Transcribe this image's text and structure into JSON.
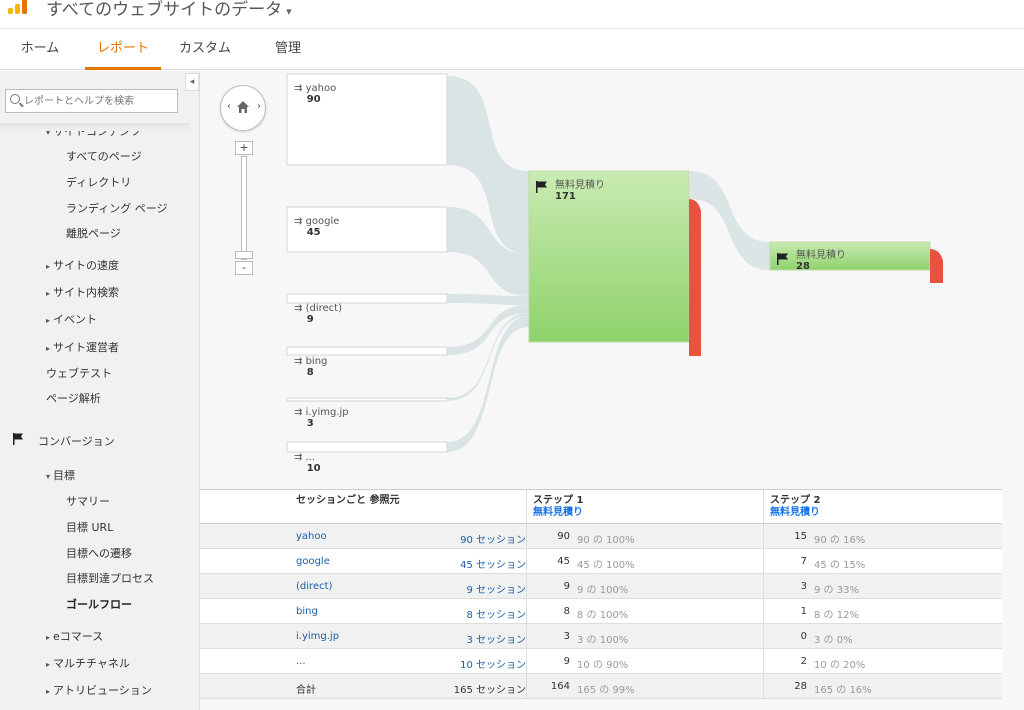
{
  "header": {
    "title": "すべてのウェブサイトのデータ"
  },
  "nav": {
    "tabs": [
      "ホーム",
      "レポート",
      "カスタム",
      "管理"
    ],
    "active": "レポート"
  },
  "sidebar": {
    "search_placeholder": "レポートとヘルプを検索",
    "partial_top": "サイトコンテンツ",
    "items": [
      "すべてのページ",
      "ディレクトリ",
      "ランディング ページ",
      "離脱ページ",
      "サイトの速度",
      "サイト内検索",
      "イベント",
      "サイト運営者",
      "ウェブテスト",
      "ページ解析",
      "コンバージョン",
      "目標",
      "サマリー",
      "目標 URL",
      "目標への遷移",
      "目標到達プロセス",
      "ゴールフロー",
      "eコマース",
      "マルチチャネル",
      "アトリビューション"
    ]
  },
  "flow": {
    "sources": [
      {
        "name": "yahoo",
        "value": "90"
      },
      {
        "name": "google",
        "value": "45"
      },
      {
        "name": "(direct)",
        "value": "9"
      },
      {
        "name": "bing",
        "value": "8"
      },
      {
        "name": "i.yimg.jp",
        "value": "3"
      },
      {
        "name": "...",
        "value": "10"
      }
    ],
    "step1": {
      "name": "無料見積り",
      "value": "171"
    },
    "step2": {
      "name": "無料見積り",
      "value": "28"
    },
    "colors": {
      "node_green": "#8fd26b",
      "dropoff_red": "#e8533f",
      "link_gray": "#d9e4e4"
    }
  },
  "table": {
    "headers": {
      "source": "セッションごと 参照元",
      "step1": "ステップ 1",
      "step1_sub": "無料見積り",
      "step2": "ステップ 2",
      "step2_sub": "無料見積り"
    },
    "rows": [
      {
        "name": "yahoo",
        "sessions": "90 セッション",
        "s1n": "90",
        "s1p": "90 の 100%",
        "s2n": "15",
        "s2p": "90 の 16%"
      },
      {
        "name": "google",
        "sessions": "45 セッション",
        "s1n": "45",
        "s1p": "45 の 100%",
        "s2n": "7",
        "s2p": "45 の 15%"
      },
      {
        "name": "(direct)",
        "sessions": "9 セッション",
        "s1n": "9",
        "s1p": "9 の 100%",
        "s2n": "3",
        "s2p": "9 の 33%"
      },
      {
        "name": "bing",
        "sessions": "8 セッション",
        "s1n": "8",
        "s1p": "8 の 100%",
        "s2n": "1",
        "s2p": "8 の 12%"
      },
      {
        "name": "i.yimg.jp",
        "sessions": "3 セッション",
        "s1n": "3",
        "s1p": "3 の 100%",
        "s2n": "0",
        "s2p": "3 の 0%"
      },
      {
        "name": "...",
        "sessions": "10 セッション",
        "s1n": "9",
        "s1p": "10 の 90%",
        "s2n": "2",
        "s2p": "10 の 20%"
      }
    ],
    "total": {
      "name": "合計",
      "sessions": "165 セッション",
      "s1n": "164",
      "s1p": "165 の 99%",
      "s2n": "28",
      "s2p": "165 の 16%"
    }
  }
}
